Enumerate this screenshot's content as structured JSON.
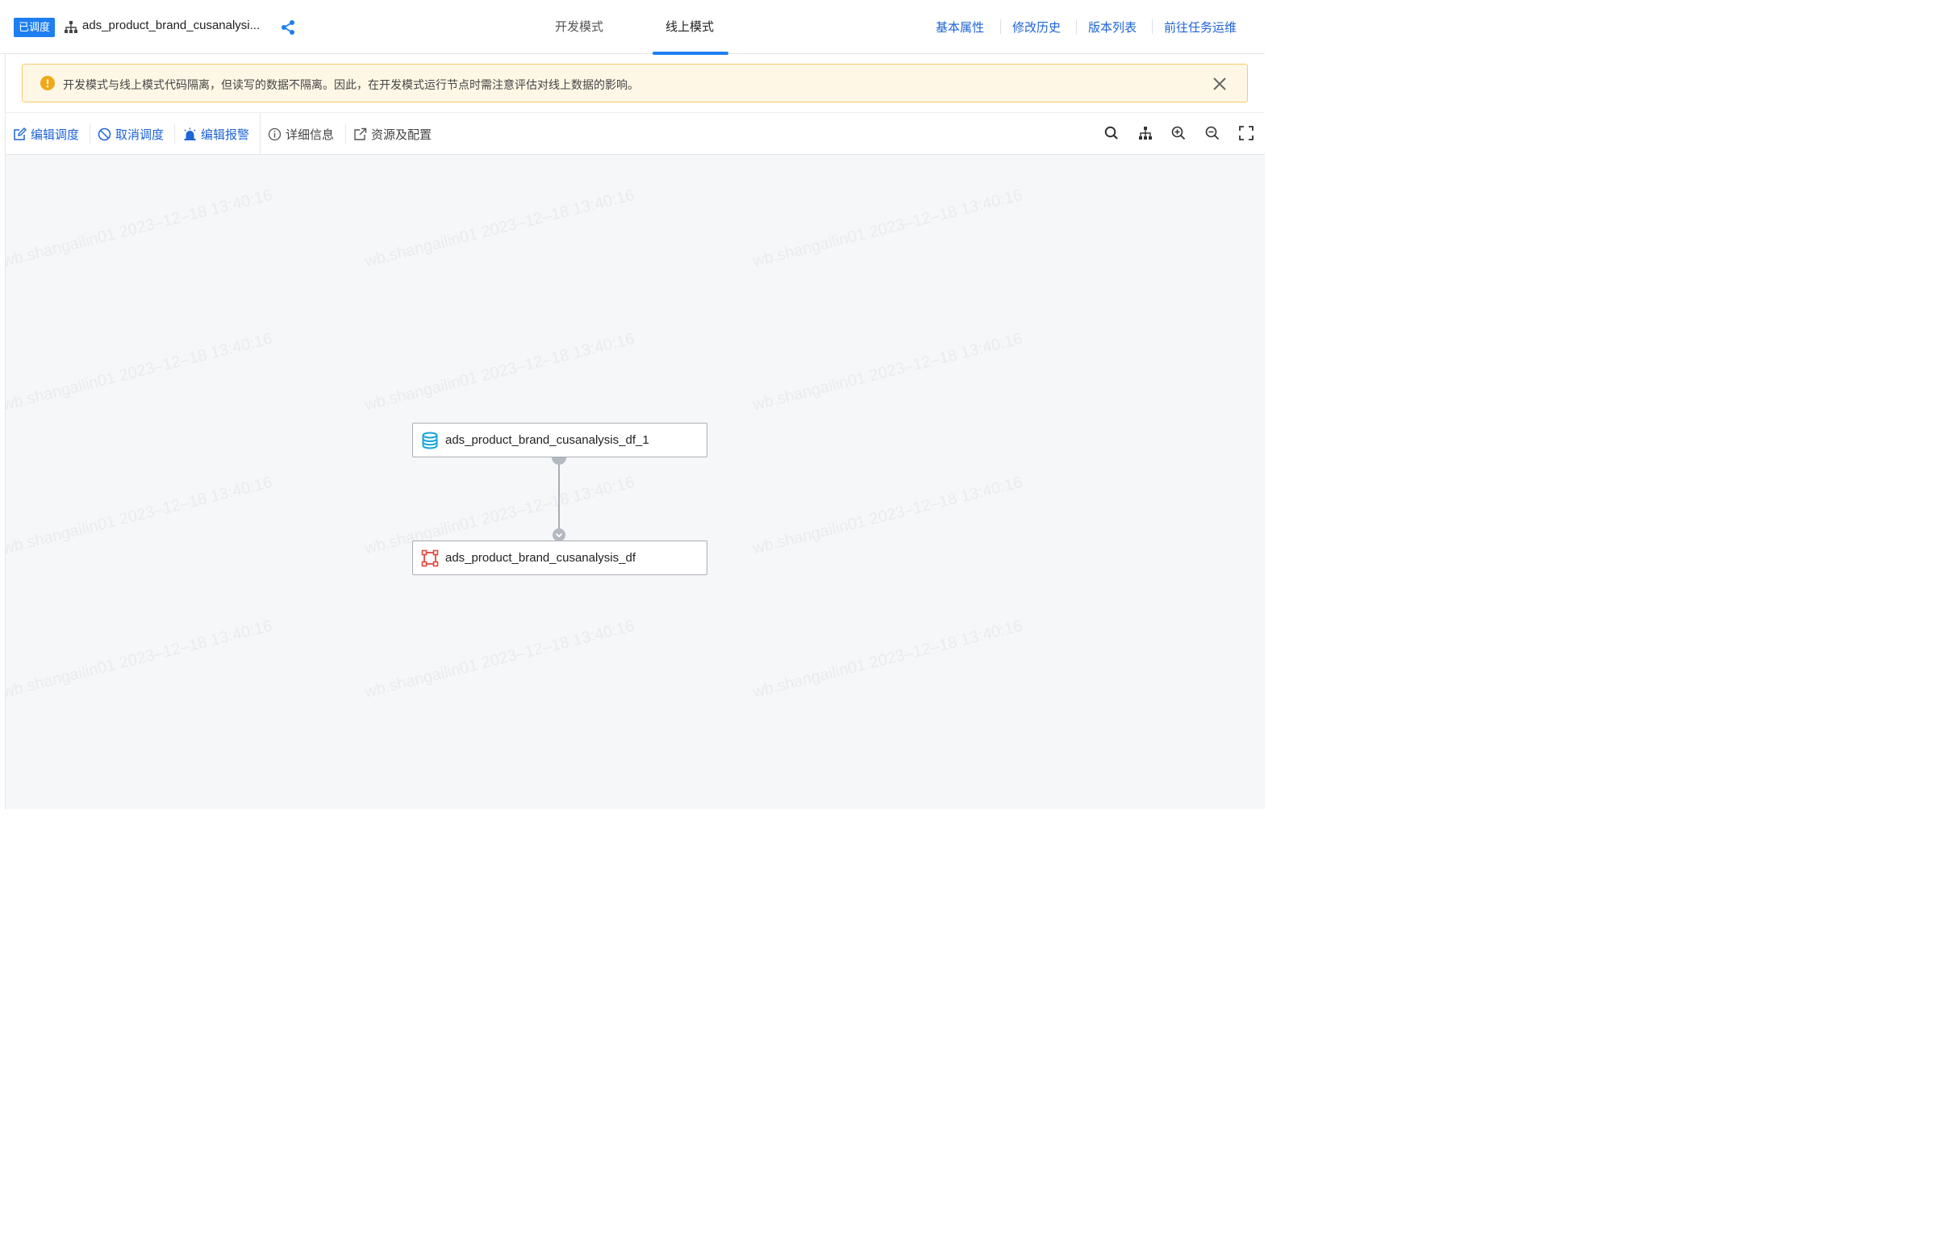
{
  "header": {
    "status_badge": "已调度",
    "task_name": "ads_product_brand_cusanalysi...",
    "tabs": [
      "开发模式",
      "线上模式"
    ],
    "active_tab": "线上模式",
    "links": [
      "基本属性",
      "修改历史",
      "版本列表",
      "前往任务运维"
    ]
  },
  "warning": {
    "text": "开发模式与线上模式代码隔离，但读写的数据不隔离。因此，在开发模式运行节点时需注意评估对线上数据的影响。"
  },
  "toolbar": {
    "edit_schedule": "编辑调度",
    "cancel_schedule": "取消调度",
    "edit_alarm": "编辑报警",
    "details": "详细信息",
    "resources": "资源及配置",
    "tools": [
      "search-icon",
      "layout-tree-icon",
      "zoom-in-icon",
      "zoom-out-icon",
      "fullscreen-icon"
    ]
  },
  "graph": {
    "nodes": [
      {
        "label": "ads_product_brand_cusanalysis_df_1",
        "icon": "database-icon"
      },
      {
        "label": "ads_product_brand_cusanalysis_df",
        "icon": "transform-node-icon"
      }
    ]
  },
  "watermark": "wb.shangailin01 2023–12–18 13:40:16",
  "colors": {
    "accent": "#1e7ff0",
    "link": "#1e63d8",
    "warning_bg": "#fff7e6",
    "warning_border": "#f7c96a",
    "warning_icon": "#f0a818",
    "db_icon": "#17a5d8",
    "node_icon": "#e0463c"
  }
}
